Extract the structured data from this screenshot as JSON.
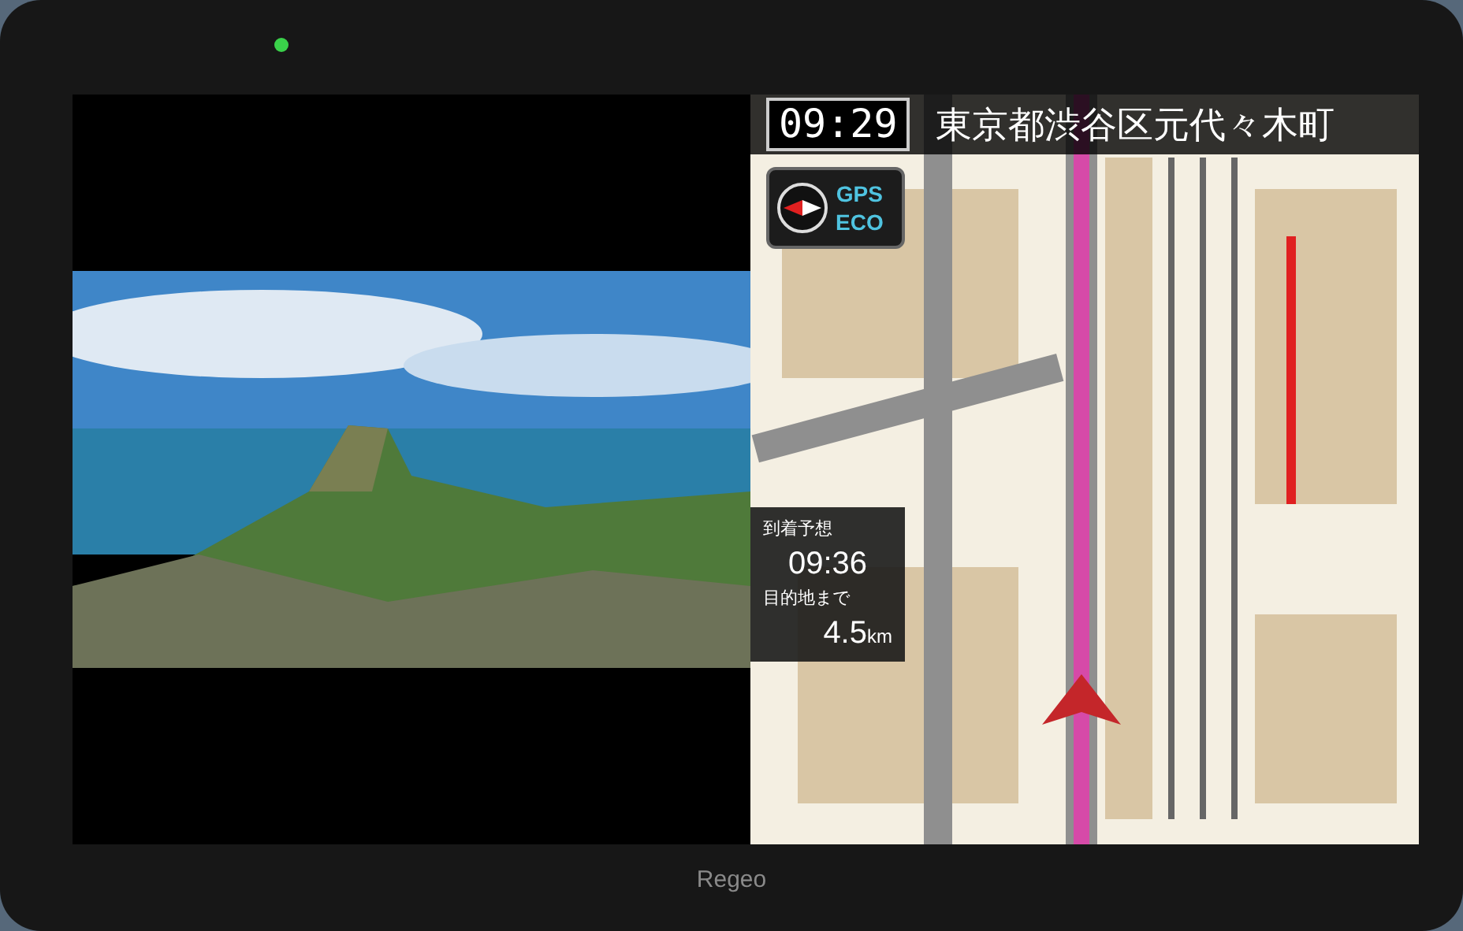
{
  "device": {
    "brand": "Regeo",
    "power_led_on": true
  },
  "header": {
    "clock": "09:29",
    "address": "東京都渋谷区元代々木町"
  },
  "mode_button": {
    "labels": [
      "GPS",
      "ECO"
    ]
  },
  "arrival": {
    "eta_label": "到着予想",
    "eta": "09:36",
    "distance_label": "目的地まで",
    "distance": "4.5",
    "distance_unit": "km"
  }
}
